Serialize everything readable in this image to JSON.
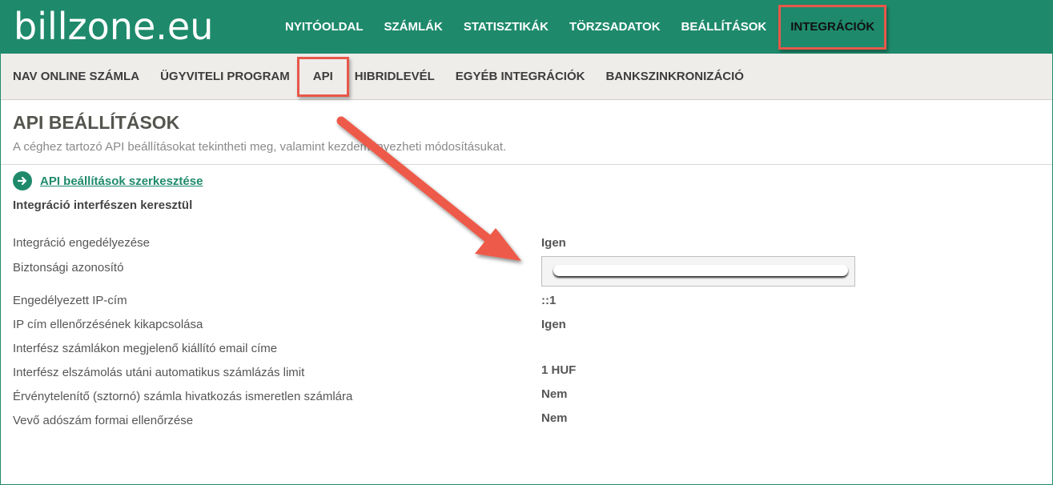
{
  "brand": {
    "logo_text": "billzone.eu"
  },
  "main_nav": [
    {
      "label": "NYITÓOLDAL"
    },
    {
      "label": "SZÁMLÁK"
    },
    {
      "label": "STATISZTIKÁK"
    },
    {
      "label": "TÖRZSADATOK"
    },
    {
      "label": "BEÁLLÍTÁSOK"
    },
    {
      "label": "INTEGRÁCIÓK",
      "active": true
    }
  ],
  "sub_nav": [
    {
      "label": "NAV ONLINE SZÁMLA"
    },
    {
      "label": "ÜGYVITELI PROGRAM"
    },
    {
      "label": "API",
      "active": true
    },
    {
      "label": "HIBRIDLEVÉL"
    },
    {
      "label": "EGYÉB INTEGRÁCIÓK"
    },
    {
      "label": "BANKSZINKRONIZÁCIÓ"
    }
  ],
  "page": {
    "title": "API BEÁLLÍTÁSOK",
    "subtitle": "A céghez tartozó API beállításokat tekintheti meg, valamint kezdeményezheti módosításukat.",
    "edit_link": "API beállítások szerkesztése",
    "section_title": "Integráció interfészen keresztül"
  },
  "settings": [
    {
      "label": "Integráció engedélyezése",
      "value": "Igen"
    },
    {
      "label": "Biztonsági azonosító",
      "value": ""
    },
    {
      "label": "Engedélyezett IP-cím",
      "value": "::1"
    },
    {
      "label": "IP cím ellenőrzésének kikapcsolása",
      "value": "Igen"
    },
    {
      "label": "Interfész számlákon megjelenő kiállító email címe",
      "value": ""
    },
    {
      "label": "Interfész elszámolás utáni automatikus számlázás limit",
      "value": "1 HUF"
    },
    {
      "label": "Érvénytelenítő (sztornó) számla hivatkozás ismeretlen számlára",
      "value": "Nem"
    },
    {
      "label": "Vevő adószám formai ellenőrzése",
      "value": "Nem"
    }
  ],
  "colors": {
    "brand_green": "#1e8a6b",
    "highlight_red": "#e8584a",
    "subnav_bg": "#efedea"
  },
  "icons": {
    "edit_link_icon": "arrow-right-circle-icon"
  }
}
